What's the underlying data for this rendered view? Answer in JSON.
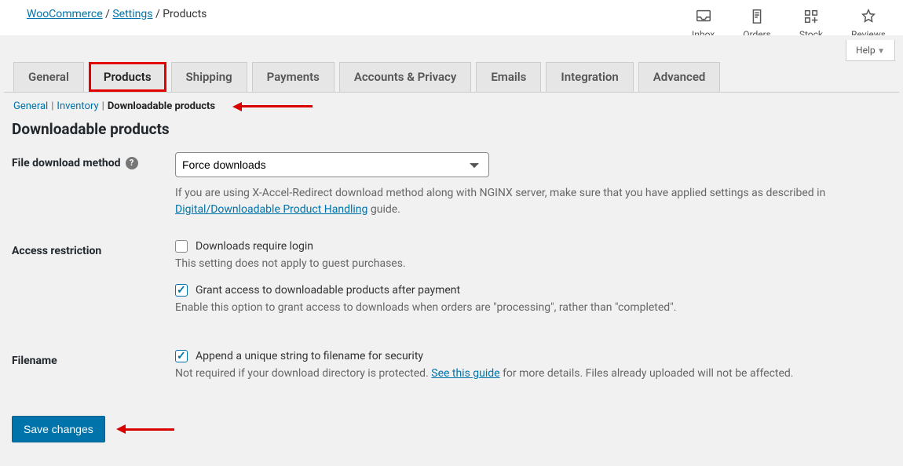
{
  "breadcrumb": {
    "a": "WooCommerce",
    "b": "Settings",
    "c": "Products"
  },
  "topicons": {
    "inbox": "Inbox",
    "orders": "Orders",
    "stock": "Stock",
    "reviews": "Reviews"
  },
  "helpTab": "Help",
  "tabs": {
    "general": "General",
    "products": "Products",
    "shipping": "Shipping",
    "payments": "Payments",
    "accounts": "Accounts & Privacy",
    "emails": "Emails",
    "integration": "Integration",
    "advanced": "Advanced"
  },
  "subnav": {
    "general": "General",
    "inventory": "Inventory",
    "downloadable": "Downloadable products"
  },
  "heading": "Downloadable products",
  "fdm": {
    "label": "File download method",
    "selected": "Force downloads",
    "desc1": "If you are using X-Accel-Redirect download method along with NGINX server, make sure that you have applied settings as described in ",
    "link": "Digital/Downloadable Product Handling",
    "desc2": " guide."
  },
  "access": {
    "label": "Access restriction",
    "cb1": "Downloads require login",
    "cb1desc": "This setting does not apply to guest purchases.",
    "cb2": "Grant access to downloadable products after payment",
    "cb2desc": "Enable this option to grant access to downloads when orders are \"processing\", rather than \"completed\"."
  },
  "filename": {
    "label": "Filename",
    "cb": "Append a unique string to filename for security",
    "desc1": "Not required if your download directory is protected. ",
    "link": "See this guide",
    "desc2": " for more details. Files already uploaded will not be affected."
  },
  "save": "Save changes"
}
